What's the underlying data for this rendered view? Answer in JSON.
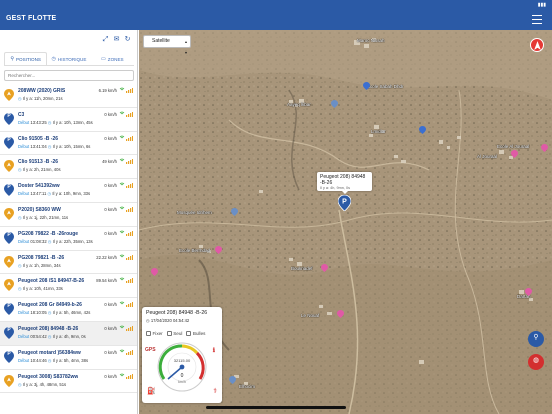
{
  "app": {
    "title": "GEST FLOTTE"
  },
  "tabs": [
    {
      "label": "POSITIONS",
      "icon": "pin-icon"
    },
    {
      "label": "HISTORIQUE",
      "icon": "clock-icon"
    },
    {
      "label": "ZONES",
      "icon": "zones-icon"
    }
  ],
  "search": {
    "placeholder": "Rechercher..."
  },
  "vehicles": [
    {
      "name": "208WW (2020) GRIS",
      "sub_label": "",
      "sub_time": "",
      "sub_since": "Il y a: 11h, 20mn, 21s",
      "speed": "6.19 km/h",
      "type": "moving",
      "selected": false
    },
    {
      "name": "C3",
      "sub_label": "Début",
      "sub_time": "13:43:25",
      "sub_since": "Il y a: 10h, 13mn, 45s",
      "speed": "0 km/h",
      "type": "parked",
      "selected": false
    },
    {
      "name": "Clio 91505 -B -26",
      "sub_label": "Début",
      "sub_time": "13:41:04",
      "sub_since": "Il y a: 10h, 15mn, 6s",
      "speed": "0 km/h",
      "type": "parked",
      "selected": false
    },
    {
      "name": "Clio 91513 -B -26",
      "sub_label": "",
      "sub_time": "",
      "sub_since": "Il y a: 2h, 21mn, 40s",
      "speed": "49 km/h",
      "type": "moving",
      "selected": false
    },
    {
      "name": "Doster 541392ww",
      "sub_label": "Début",
      "sub_time": "13:47:11",
      "sub_since": "Il y a: 10h, 9mn, 33s",
      "speed": "0 km/h",
      "type": "parked",
      "selected": false
    },
    {
      "name": "P2020) S8360 WW",
      "sub_label": "",
      "sub_time": "",
      "sub_since": "Il y a: 1j, 22h, 21mn, 11s",
      "speed": "0 km/h",
      "type": "moving",
      "selected": false
    },
    {
      "name": "PG208 79822 -B -26rouge",
      "sub_label": "Début",
      "sub_time": "01:08:32",
      "sub_since": "Il y a: 22h, 35mn, 13s",
      "speed": "0 km/h",
      "type": "parked",
      "selected": false
    },
    {
      "name": "PG208 79821 -B -26",
      "sub_label": "",
      "sub_time": "",
      "sub_since": "Il y a: 1h, 28mn, 34s",
      "speed": "22.22 km/h",
      "type": "moving",
      "selected": false
    },
    {
      "name": "Peugeot 208 /S1 84947-B-26",
      "sub_label": "",
      "sub_time": "",
      "sub_since": "Il y a: 10h, 41mn, 33s",
      "speed": "89.54 km/h",
      "type": "moving",
      "selected": false
    },
    {
      "name": "Peugeot 208 Gr 84949-b-26",
      "sub_label": "Début",
      "sub_time": "18:10:05",
      "sub_since": "Il y a: 5h, 46mn, 42s",
      "speed": "0 km/h",
      "type": "parked",
      "selected": false
    },
    {
      "name": "Peugeot 208) 84948 -B-26",
      "sub_label": "Début",
      "sub_time": "00:54:42",
      "sub_since": "Il y a: 4h, 9mn, 0s",
      "speed": "0 km/h",
      "type": "parked",
      "selected": true
    },
    {
      "name": "Peugeot motard )56384ww",
      "sub_label": "Début",
      "sub_time": "10:44:46",
      "sub_since": "Il y a: 5h, 4mn, 38s",
      "speed": "0 km/h",
      "type": "parked",
      "selected": false
    },
    {
      "name": "Peugeot 3008) S83782ww",
      "sub_label": "",
      "sub_time": "",
      "sub_since": "Il y a: 3j, 4h, 48mn, 51s",
      "speed": "0 km/h",
      "type": "moving",
      "selected": false
    }
  ],
  "map": {
    "layer_select": "Satellite",
    "labels": [
      "Maroc Nissah",
      "Ecole Sabah Dhdr",
      "Aayeq lkbar",
      "Lmidiar",
      "Al Jouraal",
      "Ecole Al Jouraal",
      "Mosquée Idrihem",
      "Ecole Berrhdad",
      "Bouknadef",
      "Le Nouaf",
      "Dartan",
      "Elhocim"
    ],
    "popup": {
      "title": "Peugeot 208) 84948",
      "title2": "-B-26",
      "sub": "Il y a: 4h, 9mn, 0s"
    }
  },
  "detail_panel": {
    "title": "Peugeot 208) 84948 -B-26",
    "datetime": "17/04/2020 04:54:42",
    "options": [
      "Fixer",
      "Seul",
      "Bulles"
    ],
    "gps_label": "GPS",
    "odometer": "32115.00",
    "speed_value": "0",
    "speed_unit": "km/h"
  },
  "colors": {
    "brand": "#2b5aa6",
    "moving_pin": "#e8a122",
    "parked_pin": "#2b5aa6",
    "danger": "#d32f2f"
  }
}
